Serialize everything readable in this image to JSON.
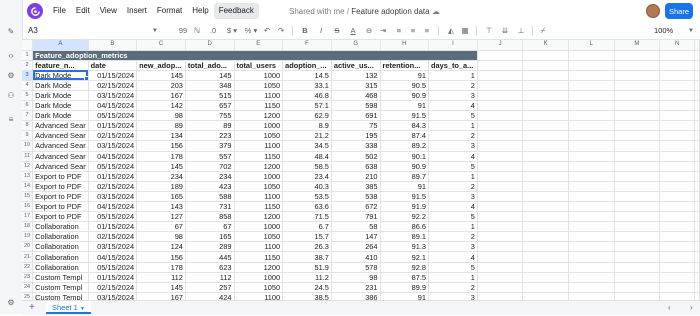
{
  "app": {
    "brand_color": "#7b3fe4",
    "accent": "#1a73e8"
  },
  "menu": [
    "File",
    "Edit",
    "View",
    "Insert",
    "Format",
    "Help",
    "Feedback"
  ],
  "doc": {
    "location": "Shared with me",
    "separator": "/",
    "title": "Feature adoption data"
  },
  "share_label": "Share",
  "toolbar": {
    "cell_ref": "A3",
    "zoom": "100%",
    "zoom_level": 1.0
  },
  "column_letters": [
    "A",
    "B",
    "C",
    "D",
    "E",
    "F",
    "G",
    "H",
    "I",
    "J",
    "K",
    "L",
    "M",
    "N"
  ],
  "sheet": {
    "title": "Feature_adoption_metrics",
    "headers": [
      "feature_n...",
      "date",
      "new_adop...",
      "total_ado...",
      "total_users",
      "adoption_...",
      "active_us...",
      "retention...",
      "days_to_a..."
    ],
    "rows": [
      [
        "Dark Mode",
        "01/15/2024",
        "145",
        "145",
        "1000",
        "14.5",
        "132",
        "91",
        "1"
      ],
      [
        "Dark Mode",
        "02/15/2024",
        "203",
        "348",
        "1050",
        "33.1",
        "315",
        "90.5",
        "2"
      ],
      [
        "Dark Mode",
        "03/15/2024",
        "167",
        "515",
        "1100",
        "46.8",
        "468",
        "90.9",
        "3"
      ],
      [
        "Dark Mode",
        "04/15/2024",
        "142",
        "657",
        "1150",
        "57.1",
        "598",
        "91",
        "4"
      ],
      [
        "Dark Mode",
        "05/15/2024",
        "98",
        "755",
        "1200",
        "62.9",
        "691",
        "91.5",
        "5"
      ],
      [
        "Advanced Sear",
        "01/15/2024",
        "89",
        "89",
        "1000",
        "8.9",
        "75",
        "84.3",
        "1"
      ],
      [
        "Advanced Sear",
        "02/15/2024",
        "134",
        "223",
        "1050",
        "21.2",
        "195",
        "87.4",
        "2"
      ],
      [
        "Advanced Sear",
        "03/15/2024",
        "156",
        "379",
        "1100",
        "34.5",
        "338",
        "89.2",
        "3"
      ],
      [
        "Advanced Sear",
        "04/15/2024",
        "178",
        "557",
        "1150",
        "48.4",
        "502",
        "90.1",
        "4"
      ],
      [
        "Advanced Sear",
        "05/15/2024",
        "145",
        "702",
        "1200",
        "58.5",
        "638",
        "90.9",
        "5"
      ],
      [
        "Export to PDF",
        "01/15/2024",
        "234",
        "234",
        "1000",
        "23.4",
        "210",
        "89.7",
        "1"
      ],
      [
        "Export to PDF",
        "02/15/2024",
        "189",
        "423",
        "1050",
        "40.3",
        "385",
        "91",
        "2"
      ],
      [
        "Export to PDF",
        "03/15/2024",
        "165",
        "588",
        "1100",
        "53.5",
        "538",
        "91.5",
        "3"
      ],
      [
        "Export to PDF",
        "04/15/2024",
        "143",
        "731",
        "1150",
        "63.6",
        "672",
        "91.9",
        "4"
      ],
      [
        "Export to PDF",
        "05/15/2024",
        "127",
        "858",
        "1200",
        "71.5",
        "791",
        "92.2",
        "5"
      ],
      [
        "Collaboration",
        "01/15/2024",
        "67",
        "67",
        "1000",
        "6.7",
        "58",
        "86.6",
        "1"
      ],
      [
        "Collaboration",
        "02/15/2024",
        "98",
        "165",
        "1050",
        "15.7",
        "147",
        "89.1",
        "2"
      ],
      [
        "Collaboration",
        "03/15/2024",
        "124",
        "289",
        "1100",
        "26.3",
        "264",
        "91.3",
        "3"
      ],
      [
        "Collaboration",
        "04/15/2024",
        "156",
        "445",
        "1150",
        "38.7",
        "410",
        "92.1",
        "4"
      ],
      [
        "Collaboration",
        "05/15/2024",
        "178",
        "623",
        "1200",
        "51.9",
        "578",
        "92.8",
        "5"
      ],
      [
        "Custom Templ",
        "01/15/2024",
        "112",
        "112",
        "1000",
        "11.2",
        "98",
        "87.5",
        "1"
      ],
      [
        "Custom Templ",
        "02/15/2024",
        "145",
        "257",
        "1050",
        "24.5",
        "231",
        "89.9",
        "2"
      ],
      [
        "Custom Templ",
        "03/15/2024",
        "167",
        "424",
        "1100",
        "38.5",
        "386",
        "91",
        "3"
      ]
    ]
  },
  "sheet_tab": "Sheet 1"
}
